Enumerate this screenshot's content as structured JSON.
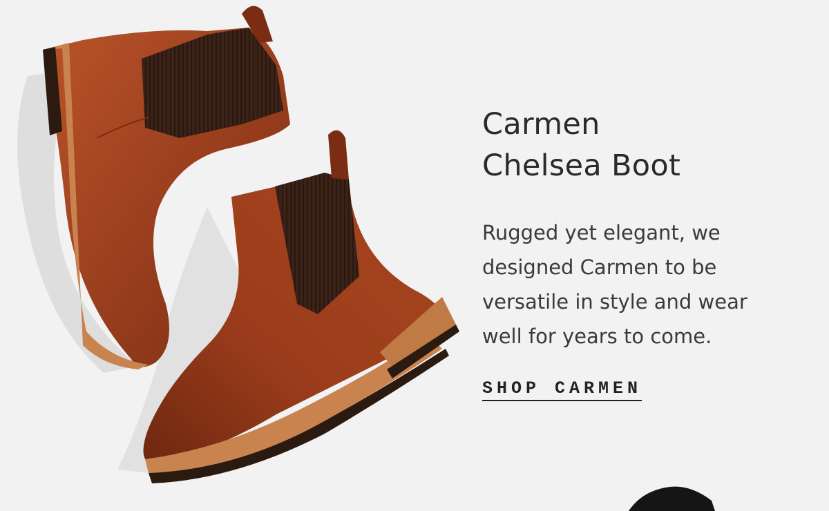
{
  "product": {
    "title_line1": "Carmen",
    "title_line2": "Chelsea Boot",
    "description": "Rugged yet elegant, we designed Carmen to be versatile in style and wear well for years to come.",
    "cta_label": "SHOP CARMEN"
  },
  "colors": {
    "background": "#f2f2f2",
    "leather": "#9b3f1e",
    "elastic": "#3b2318",
    "sole": "#c8834e",
    "text": "#2a2a2a"
  }
}
